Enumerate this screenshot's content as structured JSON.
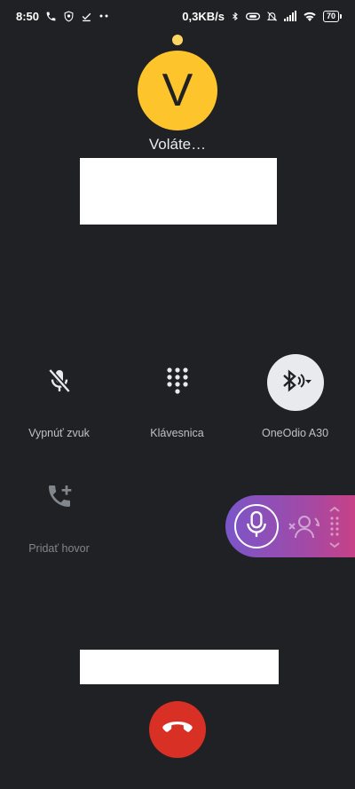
{
  "status_bar": {
    "time": "8:50",
    "net_speed": "0,3KB/s",
    "battery": "70",
    "left_icons": [
      "phone-icon",
      "shield-icon",
      "check-icon",
      "more-dots-icon"
    ],
    "right_icons": [
      "bluetooth-icon",
      "link-icon",
      "bell-off-icon",
      "signal-icon",
      "wifi-icon",
      "battery-icon"
    ]
  },
  "call": {
    "avatar_letter": "V",
    "status_text": "Voláte…"
  },
  "controls": {
    "mute_label": "Vypnúť zvuk",
    "keypad_label": "Klávesnica",
    "audio_label": "OneOdio A30",
    "add_call_label": "Pridať hovor"
  },
  "colors": {
    "background": "#202124",
    "avatar": "#fdc52b",
    "end_call": "#d93025",
    "assistant_gradient_start": "#7a56c9",
    "assistant_gradient_end": "#d13f7f"
  }
}
